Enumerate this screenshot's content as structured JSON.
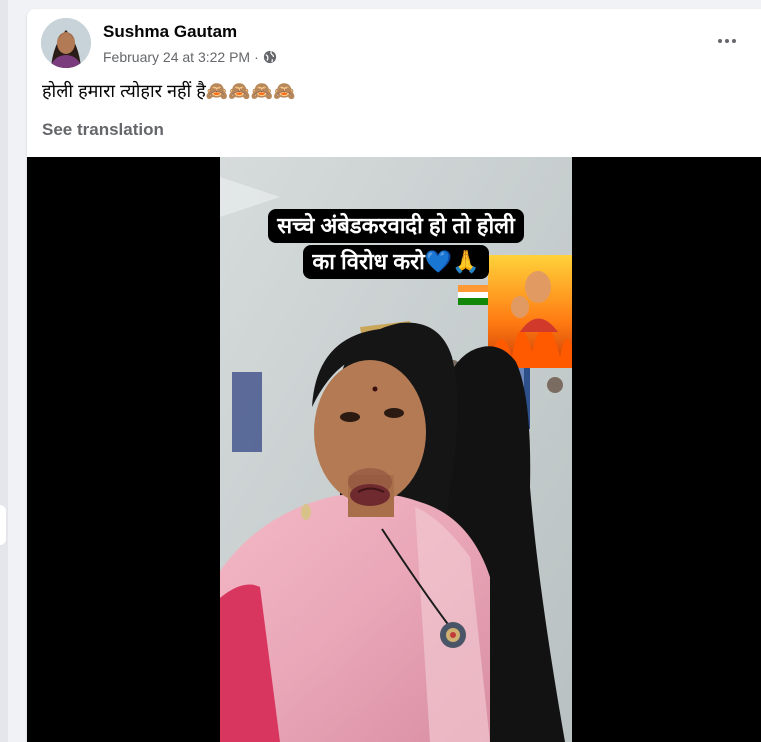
{
  "post": {
    "author": "Sushma Gautam",
    "timestamp": "February 24 at 3:22 PM",
    "separator": "·",
    "text": "होली हमारा त्योहार नहीं है🙈🙈🙈🙈",
    "see_translation": "See translation"
  },
  "video": {
    "caption_line1": "सच्चे अंबेडकरवादी हो तो होली",
    "caption_line2": "का विरोध करो💙🙏"
  },
  "icons": {
    "privacy": "globe-icon",
    "more": "more-options-icon"
  },
  "colors": {
    "page_bg": "#f0f2f5",
    "card_bg": "#ffffff",
    "name_text": "#050505",
    "secondary_text": "#65676b",
    "media_bg": "#000000"
  }
}
